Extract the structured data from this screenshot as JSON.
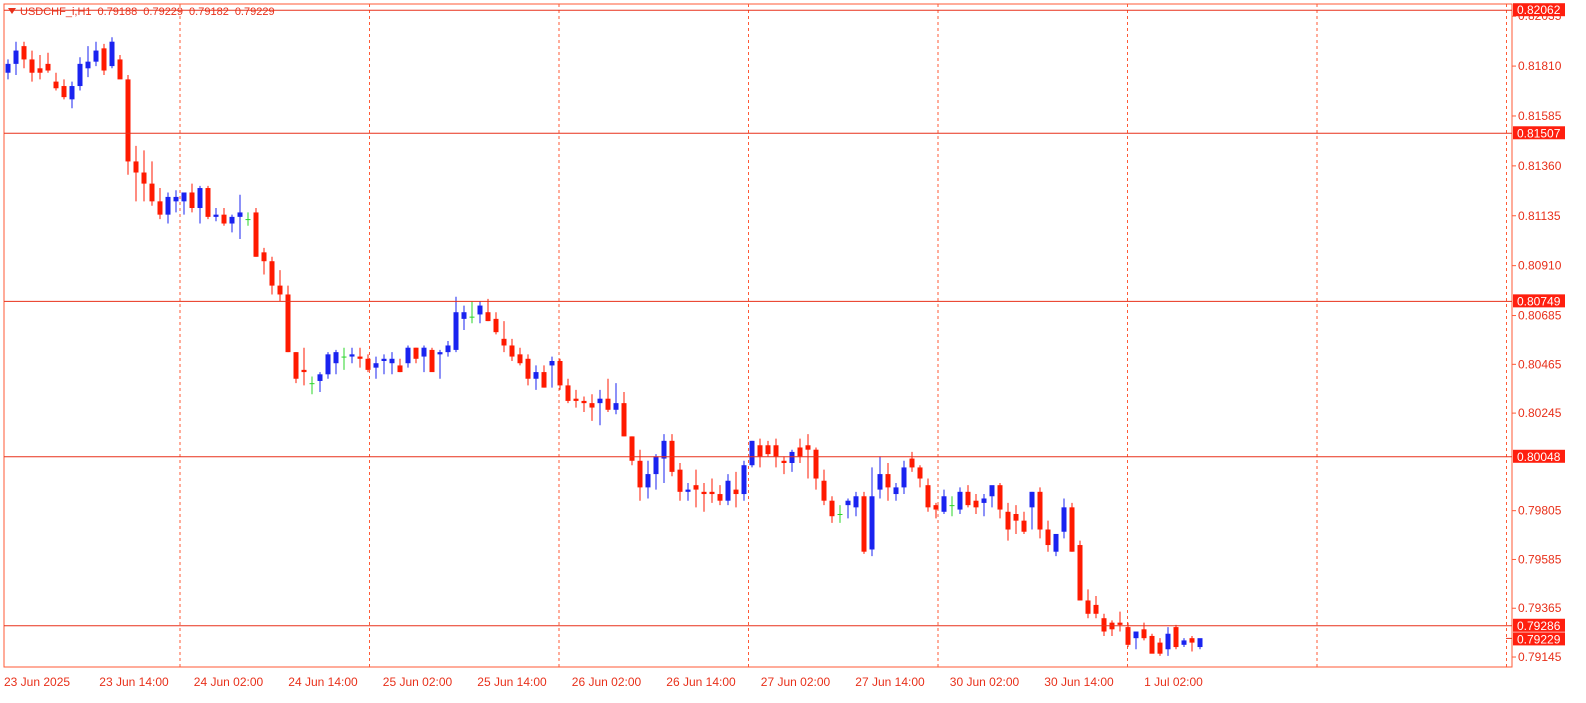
{
  "header": {
    "symbol": "USDCHF_i,H1",
    "ohlc": [
      "0.79188",
      "0.79229",
      "0.79182",
      "0.79229"
    ]
  },
  "colors": {
    "bull": "#1a23f0",
    "bear": "#ff1a00",
    "grid": "#ff5a36",
    "axis_text": "#e8301a",
    "level": "#e8301a",
    "label_bg": "#ff1f0f",
    "label_text": "#ffffff",
    "doji": "#2ad62a"
  },
  "chart_data": {
    "type": "candlestick",
    "symbol": "USDCHF_i",
    "timeframe": "H1",
    "ylim": [
      0.791,
      0.8209
    ],
    "y_ticks": [
      "0.82035",
      "0.81810",
      "0.81585",
      "0.81360",
      "0.81135",
      "0.80910",
      "0.80685",
      "0.80465",
      "0.80245",
      "0.79805",
      "0.79585",
      "0.79365",
      "0.79145"
    ],
    "x_ticks": [
      "23 Jun 2025",
      "23 Jun 14:00",
      "24 Jun 02:00",
      "24 Jun 14:00",
      "25 Jun 02:00",
      "25 Jun 14:00",
      "26 Jun 02:00",
      "26 Jun 14:00",
      "27 Jun 02:00",
      "27 Jun 14:00",
      "30 Jun 02:00",
      "30 Jun 14:00",
      "1 Jul 02:00"
    ],
    "levels": [
      "0.82062",
      "0.81507",
      "0.80749",
      "0.80048",
      "0.79286"
    ],
    "current_price": "0.79229",
    "grid": true,
    "candles": [
      [
        0.8178,
        0.8184,
        0.8175,
        0.8182
      ],
      [
        0.8182,
        0.8192,
        0.8177,
        0.8188
      ],
      [
        0.819,
        0.8192,
        0.818,
        0.8184
      ],
      [
        0.8184,
        0.8188,
        0.8174,
        0.8178
      ],
      [
        0.818,
        0.8186,
        0.8175,
        0.8178
      ],
      [
        0.8182,
        0.8187,
        0.8178,
        0.8179
      ],
      [
        0.8174,
        0.8178,
        0.817,
        0.8171
      ],
      [
        0.8172,
        0.8175,
        0.8166,
        0.8167
      ],
      [
        0.8166,
        0.8174,
        0.8162,
        0.8172
      ],
      [
        0.8172,
        0.8185,
        0.817,
        0.8182
      ],
      [
        0.818,
        0.819,
        0.8176,
        0.8183
      ],
      [
        0.8183,
        0.8192,
        0.8181,
        0.8188
      ],
      [
        0.8189,
        0.8191,
        0.8177,
        0.8179
      ],
      [
        0.8181,
        0.8194,
        0.818,
        0.8192
      ],
      [
        0.8184,
        0.8186,
        0.8176,
        0.8175
      ],
      [
        0.8175,
        0.8177,
        0.8132,
        0.8138
      ],
      [
        0.8138,
        0.8145,
        0.812,
        0.8133
      ],
      [
        0.8133,
        0.8143,
        0.812,
        0.8128
      ],
      [
        0.8128,
        0.8138,
        0.8118,
        0.812
      ],
      [
        0.812,
        0.8126,
        0.8112,
        0.8114
      ],
      [
        0.8114,
        0.8124,
        0.811,
        0.8122
      ],
      [
        0.812,
        0.8125,
        0.8115,
        0.8122
      ],
      [
        0.812,
        0.8124,
        0.8114,
        0.8124
      ],
      [
        0.8124,
        0.8128,
        0.8115,
        0.8117
      ],
      [
        0.8117,
        0.8127,
        0.811,
        0.8126
      ],
      [
        0.8126,
        0.8127,
        0.8112,
        0.8113
      ],
      [
        0.8113,
        0.8117,
        0.8111,
        0.8114
      ],
      [
        0.8114,
        0.8117,
        0.8109,
        0.811
      ],
      [
        0.811,
        0.8114,
        0.8106,
        0.8113
      ],
      [
        0.8113,
        0.8123,
        0.8103,
        0.8115
      ],
      [
        0.8112,
        0.8115,
        0.8109,
        0.8112
      ],
      [
        0.8115,
        0.8117,
        0.8095,
        0.8095
      ],
      [
        0.8097,
        0.8099,
        0.8087,
        0.8093
      ],
      [
        0.8093,
        0.8095,
        0.8078,
        0.8082
      ],
      [
        0.8082,
        0.8089,
        0.8075,
        0.8078
      ],
      [
        0.8078,
        0.8082,
        0.8052,
        0.8052
      ],
      [
        0.8052,
        0.8052,
        0.8038,
        0.804
      ],
      [
        0.8044,
        0.8054,
        0.8037,
        0.8043
      ],
      [
        0.8038,
        0.8041,
        0.8033,
        0.8038
      ],
      [
        0.8039,
        0.8043,
        0.8034,
        0.8042
      ],
      [
        0.8042,
        0.8052,
        0.804,
        0.8051
      ],
      [
        0.8047,
        0.8053,
        0.8042,
        0.8052
      ],
      [
        0.805,
        0.8054,
        0.8044,
        0.805
      ],
      [
        0.805,
        0.8054,
        0.8047,
        0.8051
      ],
      [
        0.805,
        0.8054,
        0.8045,
        0.8049
      ],
      [
        0.8049,
        0.8051,
        0.8043,
        0.8044
      ],
      [
        0.8045,
        0.805,
        0.804,
        0.8047
      ],
      [
        0.8048,
        0.8051,
        0.8042,
        0.8049
      ],
      [
        0.8047,
        0.8052,
        0.8042,
        0.8049
      ],
      [
        0.8046,
        0.8049,
        0.8043,
        0.8043
      ],
      [
        0.8047,
        0.8055,
        0.8045,
        0.8054
      ],
      [
        0.8054,
        0.8054,
        0.8047,
        0.8049
      ],
      [
        0.805,
        0.8055,
        0.8043,
        0.8054
      ],
      [
        0.8053,
        0.8054,
        0.8047,
        0.8043
      ],
      [
        0.8051,
        0.8053,
        0.804,
        0.8052
      ],
      [
        0.8052,
        0.8057,
        0.805,
        0.8055
      ],
      [
        0.8053,
        0.8077,
        0.8052,
        0.807
      ],
      [
        0.8067,
        0.8073,
        0.8062,
        0.807
      ],
      [
        0.8068,
        0.8075,
        0.8065,
        0.8068
      ],
      [
        0.8069,
        0.8075,
        0.8065,
        0.8073
      ],
      [
        0.807,
        0.8076,
        0.8066,
        0.8066
      ],
      [
        0.8067,
        0.807,
        0.806,
        0.8061
      ],
      [
        0.8058,
        0.8066,
        0.8052,
        0.8055
      ],
      [
        0.8055,
        0.8058,
        0.8048,
        0.805
      ],
      [
        0.8051,
        0.8054,
        0.8046,
        0.8047
      ],
      [
        0.8049,
        0.8051,
        0.8037,
        0.804
      ],
      [
        0.804,
        0.8046,
        0.8035,
        0.8043
      ],
      [
        0.8043,
        0.8046,
        0.8036,
        0.8036
      ],
      [
        0.8046,
        0.805,
        0.8036,
        0.8048
      ],
      [
        0.8048,
        0.8049,
        0.8035,
        0.8037
      ],
      [
        0.8037,
        0.804,
        0.8029,
        0.803
      ],
      [
        0.8031,
        0.8035,
        0.8027,
        0.803
      ],
      [
        0.803,
        0.8032,
        0.8025,
        0.8029
      ],
      [
        0.8029,
        0.8033,
        0.8021,
        0.8027
      ],
      [
        0.8029,
        0.8035,
        0.8019,
        0.8031
      ],
      [
        0.8031,
        0.804,
        0.8025,
        0.8026
      ],
      [
        0.8026,
        0.8038,
        0.8024,
        0.8029
      ],
      [
        0.8029,
        0.8034,
        0.8014,
        0.8014
      ],
      [
        0.8014,
        0.8014,
        0.8001,
        0.8003
      ],
      [
        0.8003,
        0.8008,
        0.7985,
        0.7991
      ],
      [
        0.7991,
        0.8003,
        0.7986,
        0.7997
      ],
      [
        0.7997,
        0.8006,
        0.799,
        0.8005
      ],
      [
        0.8004,
        0.8015,
        0.7993,
        0.8012
      ],
      [
        0.8012,
        0.8015,
        0.7996,
        0.7998
      ],
      [
        0.7999,
        0.8002,
        0.7985,
        0.7989
      ],
      [
        0.7989,
        0.7993,
        0.7985,
        0.799
      ],
      [
        0.7992,
        0.7999,
        0.7982,
        0.799
      ],
      [
        0.7989,
        0.7993,
        0.798,
        0.7988
      ],
      [
        0.7989,
        0.7995,
        0.7984,
        0.7988
      ],
      [
        0.7988,
        0.7992,
        0.7983,
        0.7985
      ],
      [
        0.7985,
        0.7997,
        0.7983,
        0.7994
      ],
      [
        0.799,
        0.7998,
        0.7982,
        0.7988
      ],
      [
        0.7988,
        0.8003,
        0.7985,
        0.8001
      ],
      [
        0.8001,
        0.8012,
        0.8,
        0.8012
      ],
      [
        0.801,
        0.8013,
        0.8,
        0.8005
      ],
      [
        0.801,
        0.8012,
        0.8005,
        0.8006
      ],
      [
        0.801,
        0.8013,
        0.8,
        0.8005
      ],
      [
        0.8003,
        0.8005,
        0.7997,
        0.8002
      ],
      [
        0.8002,
        0.8008,
        0.7998,
        0.8007
      ],
      [
        0.8009,
        0.8013,
        0.8002,
        0.8005
      ],
      [
        0.801,
        0.8015,
        0.7995,
        0.8008
      ],
      [
        0.8008,
        0.8009,
        0.799,
        0.7995
      ],
      [
        0.7994,
        0.7999,
        0.7983,
        0.7985
      ],
      [
        0.7985,
        0.7987,
        0.7975,
        0.7978
      ],
      [
        0.7979,
        0.7983,
        0.7975,
        0.7979
      ],
      [
        0.7983,
        0.7986,
        0.7977,
        0.7985
      ],
      [
        0.7982,
        0.7989,
        0.7978,
        0.7987
      ],
      [
        0.7987,
        0.7989,
        0.7961,
        0.7962
      ],
      [
        0.7963,
        0.8,
        0.796,
        0.7987
      ],
      [
        0.799,
        0.8005,
        0.7986,
        0.7997
      ],
      [
        0.7997,
        0.8002,
        0.7985,
        0.7991
      ],
      [
        0.7988,
        0.7993,
        0.7985,
        0.7991
      ],
      [
        0.7991,
        0.8003,
        0.7988,
        0.8
      ],
      [
        0.8004,
        0.8007,
        0.7998,
        0.8
      ],
      [
        0.8,
        0.8001,
        0.7991,
        0.7995
      ],
      [
        0.7992,
        0.7995,
        0.798,
        0.7982
      ],
      [
        0.7983,
        0.7984,
        0.7977,
        0.7981
      ],
      [
        0.798,
        0.799,
        0.7979,
        0.7987
      ],
      [
        0.7983,
        0.7987,
        0.7978,
        0.7983
      ],
      [
        0.7981,
        0.7991,
        0.7979,
        0.7989
      ],
      [
        0.7989,
        0.7992,
        0.7982,
        0.7983
      ],
      [
        0.7985,
        0.7988,
        0.7979,
        0.7982
      ],
      [
        0.7984,
        0.7988,
        0.7978,
        0.7986
      ],
      [
        0.7987,
        0.7991,
        0.7982,
        0.7992
      ],
      [
        0.7992,
        0.7993,
        0.7977,
        0.7981
      ],
      [
        0.798,
        0.7984,
        0.7967,
        0.7972
      ],
      [
        0.7979,
        0.7983,
        0.797,
        0.7976
      ],
      [
        0.7976,
        0.798,
        0.797,
        0.7971
      ],
      [
        0.7982,
        0.7989,
        0.7972,
        0.7989
      ],
      [
        0.7989,
        0.7991,
        0.7968,
        0.7972
      ],
      [
        0.7972,
        0.7976,
        0.7962,
        0.7965
      ],
      [
        0.7962,
        0.797,
        0.796,
        0.797
      ],
      [
        0.7971,
        0.7986,
        0.7968,
        0.7982
      ],
      [
        0.7982,
        0.7984,
        0.7962,
        0.7962
      ],
      [
        0.7965,
        0.7967,
        0.794,
        0.794
      ],
      [
        0.794,
        0.7945,
        0.7932,
        0.7934
      ],
      [
        0.7938,
        0.7942,
        0.7932,
        0.7934
      ],
      [
        0.7932,
        0.7934,
        0.7924,
        0.7926
      ],
      [
        0.793,
        0.7931,
        0.7924,
        0.7927
      ],
      [
        0.793,
        0.7935,
        0.7926,
        0.7929
      ],
      [
        0.7928,
        0.793,
        0.7919,
        0.792
      ],
      [
        0.7923,
        0.7926,
        0.7918,
        0.7926
      ],
      [
        0.7927,
        0.793,
        0.7922,
        0.7923
      ],
      [
        0.7924,
        0.7925,
        0.7918,
        0.7916
      ],
      [
        0.7921,
        0.7923,
        0.7915,
        0.7916
      ],
      [
        0.7918,
        0.7928,
        0.7915,
        0.7925
      ],
      [
        0.7928,
        0.7929,
        0.7918,
        0.7919
      ],
      [
        0.792,
        0.7923,
        0.7919,
        0.7922
      ],
      [
        0.7923,
        0.7924,
        0.7917,
        0.7921
      ],
      [
        0.7919,
        0.7922,
        0.7918,
        0.7923
      ]
    ]
  }
}
